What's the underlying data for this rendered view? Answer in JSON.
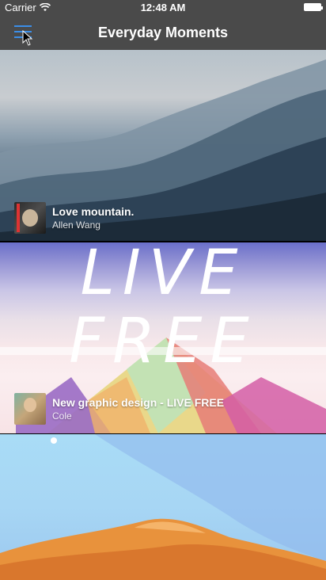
{
  "status_bar": {
    "carrier": "Carrier",
    "time": "12:48 AM"
  },
  "nav": {
    "title": "Everyday Moments"
  },
  "cards": [
    {
      "title": "Love mountain.",
      "author": "Allen Wang"
    },
    {
      "title": "New graphic design - LIVE FREE",
      "author": "Cole",
      "art_text_1": "LIVE",
      "art_text_2": "FREE"
    },
    {
      "title": "",
      "author": ""
    }
  ],
  "colors": {
    "bar": "#4a4a4a",
    "menu_accent": "#3b8ee8"
  },
  "icons": {
    "menu": "hamburger-menu-icon",
    "wifi": "wifi-icon",
    "battery": "battery-icon",
    "cursor": "mouse-cursor-icon"
  }
}
